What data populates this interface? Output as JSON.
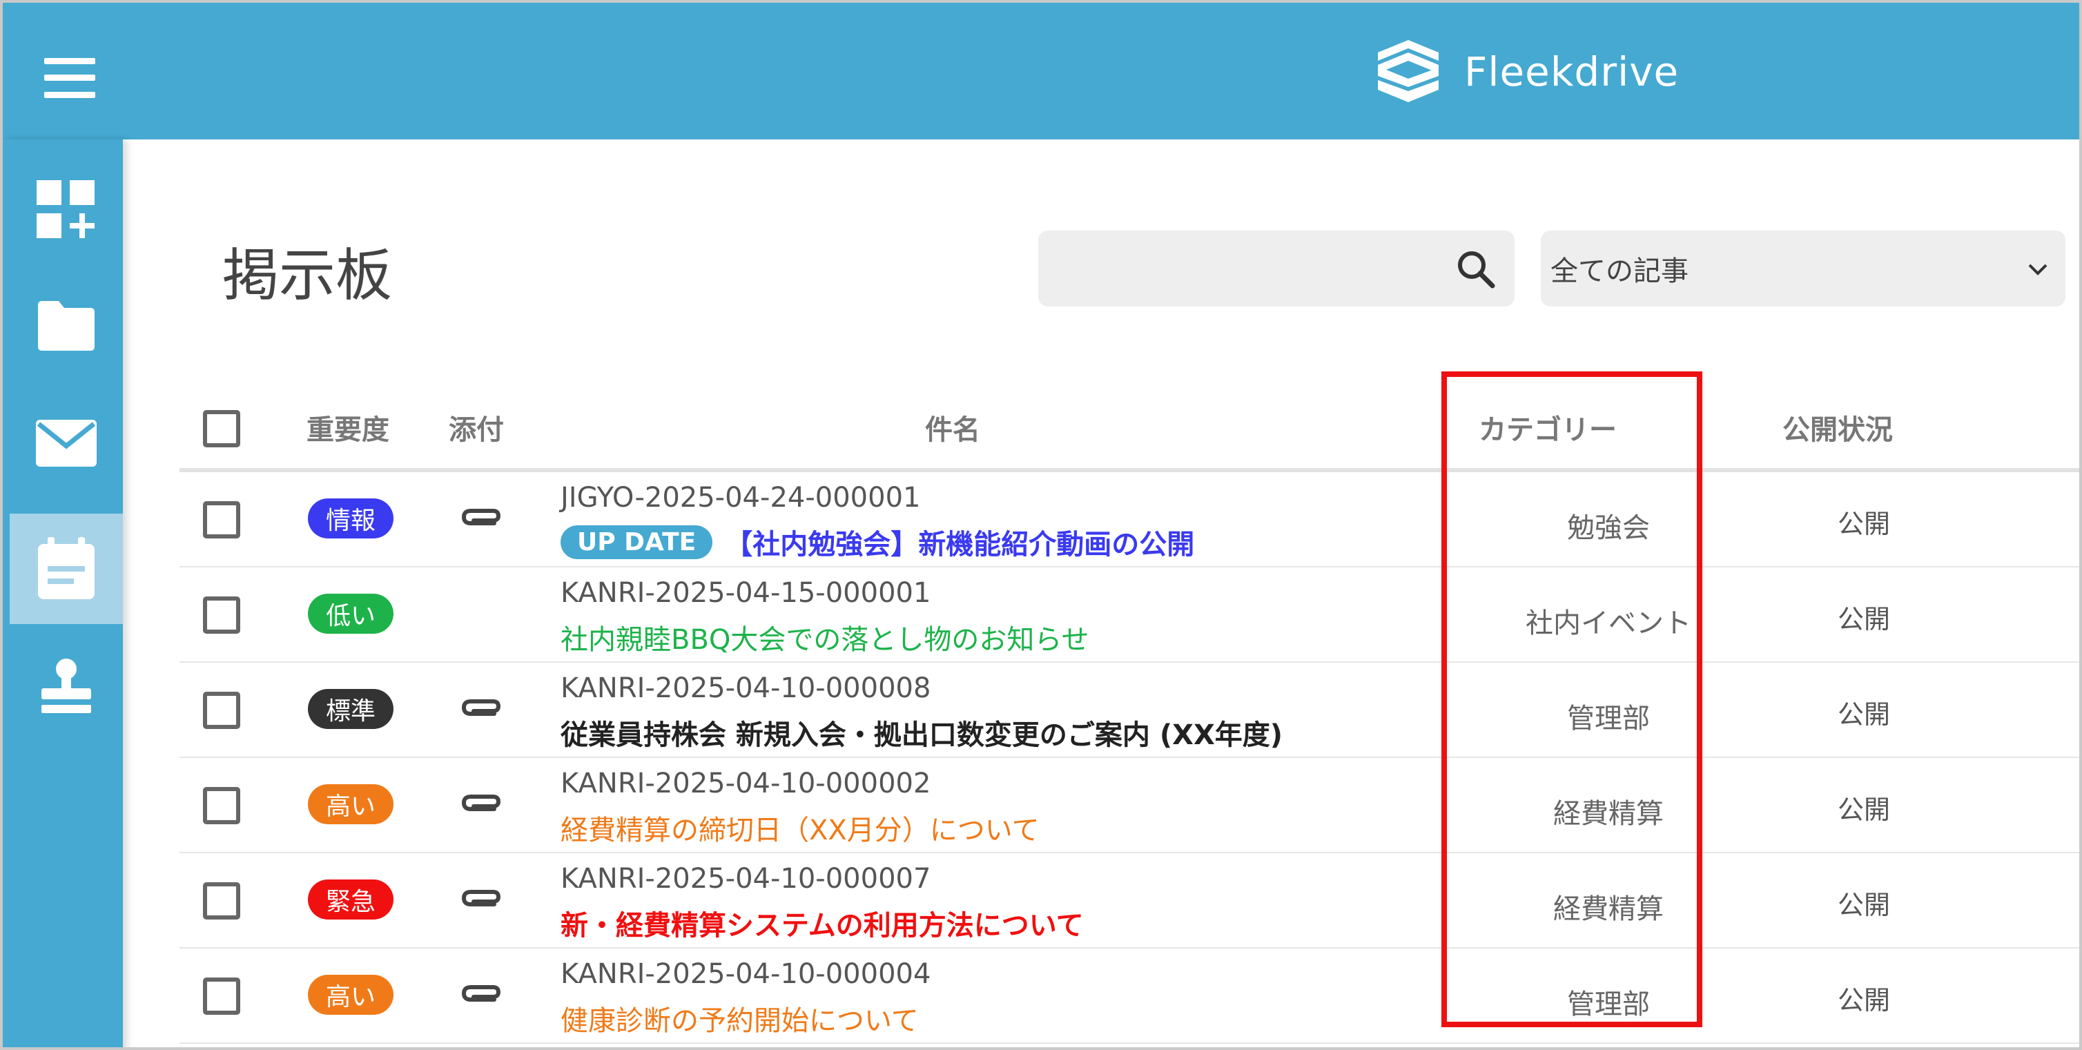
{
  "header": {
    "app_name": "Fleekdrive"
  },
  "sidebar": {
    "items": [
      {
        "name": "dashboard-add",
        "icon": "dashboard-add-icon"
      },
      {
        "name": "folder",
        "icon": "folder-icon"
      },
      {
        "name": "mail",
        "icon": "mail-icon"
      },
      {
        "name": "bulletin-board",
        "icon": "calendar-board-icon",
        "active": true
      },
      {
        "name": "stamp",
        "icon": "stamp-icon"
      }
    ]
  },
  "page": {
    "title": "掲示板",
    "search": {
      "placeholder": "",
      "value": ""
    },
    "filter": {
      "selected": "全ての記事"
    }
  },
  "table": {
    "headers": {
      "importance": "重要度",
      "attachment": "添付",
      "subject": "件名",
      "category": "カテゴリー",
      "status": "公開状況"
    },
    "rows": [
      {
        "importance": "情報",
        "badge_color": "#3a3af0",
        "attachment": true,
        "doc_id": "JIGYO-2025-04-24-000001",
        "tag": "UP DATE",
        "subject": "【社内勉強会】新機能紹介動画の公開",
        "subject_color": "#3a3af0",
        "subject_bold": true,
        "category": "勉強会",
        "status": "公開"
      },
      {
        "importance": "低い",
        "badge_color": "#1db34a",
        "attachment": false,
        "doc_id": "KANRI-2025-04-15-000001",
        "tag": "",
        "subject": "社内親睦BBQ大会での落とし物のお知らせ",
        "subject_color": "#1db34a",
        "subject_bold": false,
        "category": "社内イベント",
        "status": "公開"
      },
      {
        "importance": "標準",
        "badge_color": "#333333",
        "attachment": true,
        "doc_id": "KANRI-2025-04-10-000008",
        "tag": "",
        "subject": "従業員持株会 新規入会・拠出口数変更のご案内 (XX年度)",
        "subject_color": "#222222",
        "subject_bold": true,
        "category": "管理部",
        "status": "公開"
      },
      {
        "importance": "高い",
        "badge_color": "#f07a18",
        "attachment": true,
        "doc_id": "KANRI-2025-04-10-000002",
        "tag": "",
        "subject": "経費精算の締切日（XX月分）について",
        "subject_color": "#f07a18",
        "subject_bold": false,
        "category": "経費精算",
        "status": "公開"
      },
      {
        "importance": "緊急",
        "badge_color": "#f01010",
        "attachment": true,
        "doc_id": "KANRI-2025-04-10-000007",
        "tag": "",
        "subject": "新・経費精算システムの利用方法について",
        "subject_color": "#f01010",
        "subject_bold": true,
        "category": "経費精算",
        "status": "公開"
      },
      {
        "importance": "高い",
        "badge_color": "#f07a18",
        "attachment": true,
        "doc_id": "KANRI-2025-04-10-000004",
        "tag": "",
        "subject": "健康診断の予約開始について",
        "subject_color": "#f07a18",
        "subject_bold": false,
        "category": "管理部",
        "status": "公開"
      }
    ]
  },
  "annotation": {
    "highlight_color": "#ee1111"
  }
}
